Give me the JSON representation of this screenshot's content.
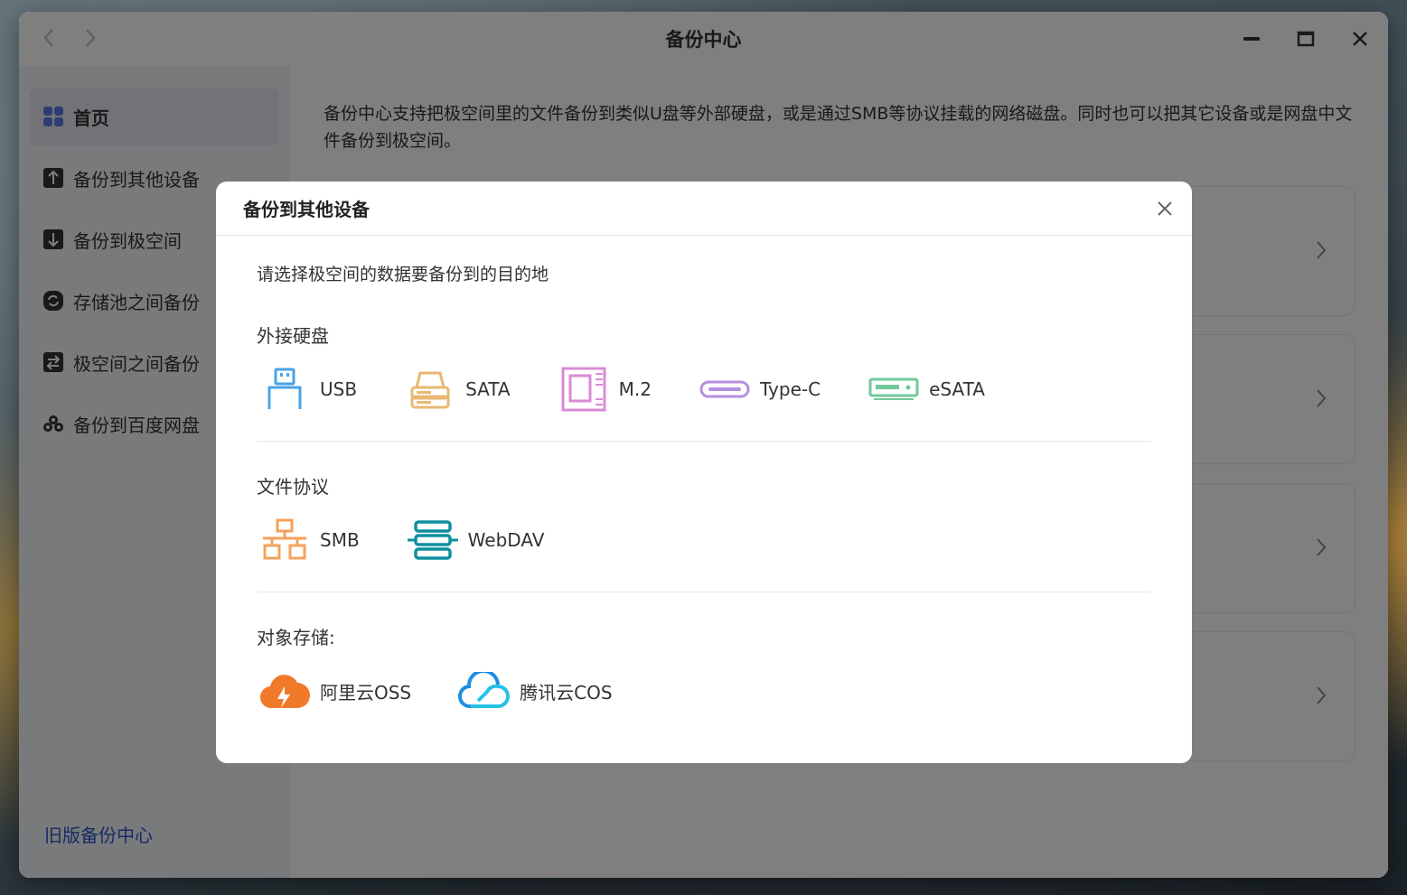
{
  "window": {
    "title": "备份中心"
  },
  "sidebar": {
    "items": [
      {
        "label": "首页",
        "icon": "grid-icon"
      },
      {
        "label": "备份到其他设备",
        "icon": "upload-icon"
      },
      {
        "label": "备份到极空间",
        "icon": "download-icon"
      },
      {
        "label": "存储池之间备份",
        "icon": "sync-icon"
      },
      {
        "label": "极空间之间备份",
        "icon": "transfer-icon"
      },
      {
        "label": "备份到百度网盘",
        "icon": "baidu-icon"
      }
    ],
    "legacy_link": "旧版备份中心"
  },
  "content": {
    "description": "备份中心支持把极空间里的文件备份到类似U盘等外部硬盘，或是通过SMB等协议挂载的网络磁盘。同时也可以把其它设备或是网盘中文件备份到极空间。"
  },
  "modal": {
    "title": "备份到其他设备",
    "prompt": "请选择极空间的数据要备份到的目的地",
    "sections": [
      {
        "title": "外接硬盘",
        "options": [
          {
            "label": "USB",
            "icon": "usb-icon",
            "color": "#4aa3e8"
          },
          {
            "label": "SATA",
            "icon": "sata-drive-icon",
            "color": "#e8b872"
          },
          {
            "label": "M.2",
            "icon": "m2-icon",
            "color": "#d98bd6"
          },
          {
            "label": "Type-C",
            "icon": "type-c-icon",
            "color": "#b48ee0"
          },
          {
            "label": "eSATA",
            "icon": "esata-icon",
            "color": "#6fc99a"
          }
        ]
      },
      {
        "title": "文件协议",
        "options": [
          {
            "label": "SMB",
            "icon": "smb-network-icon",
            "color": "#f5a25a"
          },
          {
            "label": "WebDAV",
            "icon": "webdav-icon",
            "color": "#0f8fa0"
          }
        ]
      },
      {
        "title": "对象存储:",
        "options": [
          {
            "label": "阿里云OSS",
            "icon": "aliyun-oss-icon",
            "color": "#f07a2a"
          },
          {
            "label": "腾讯云COS",
            "icon": "tencent-cos-icon",
            "color": "#1c8fe0"
          }
        ]
      }
    ]
  }
}
